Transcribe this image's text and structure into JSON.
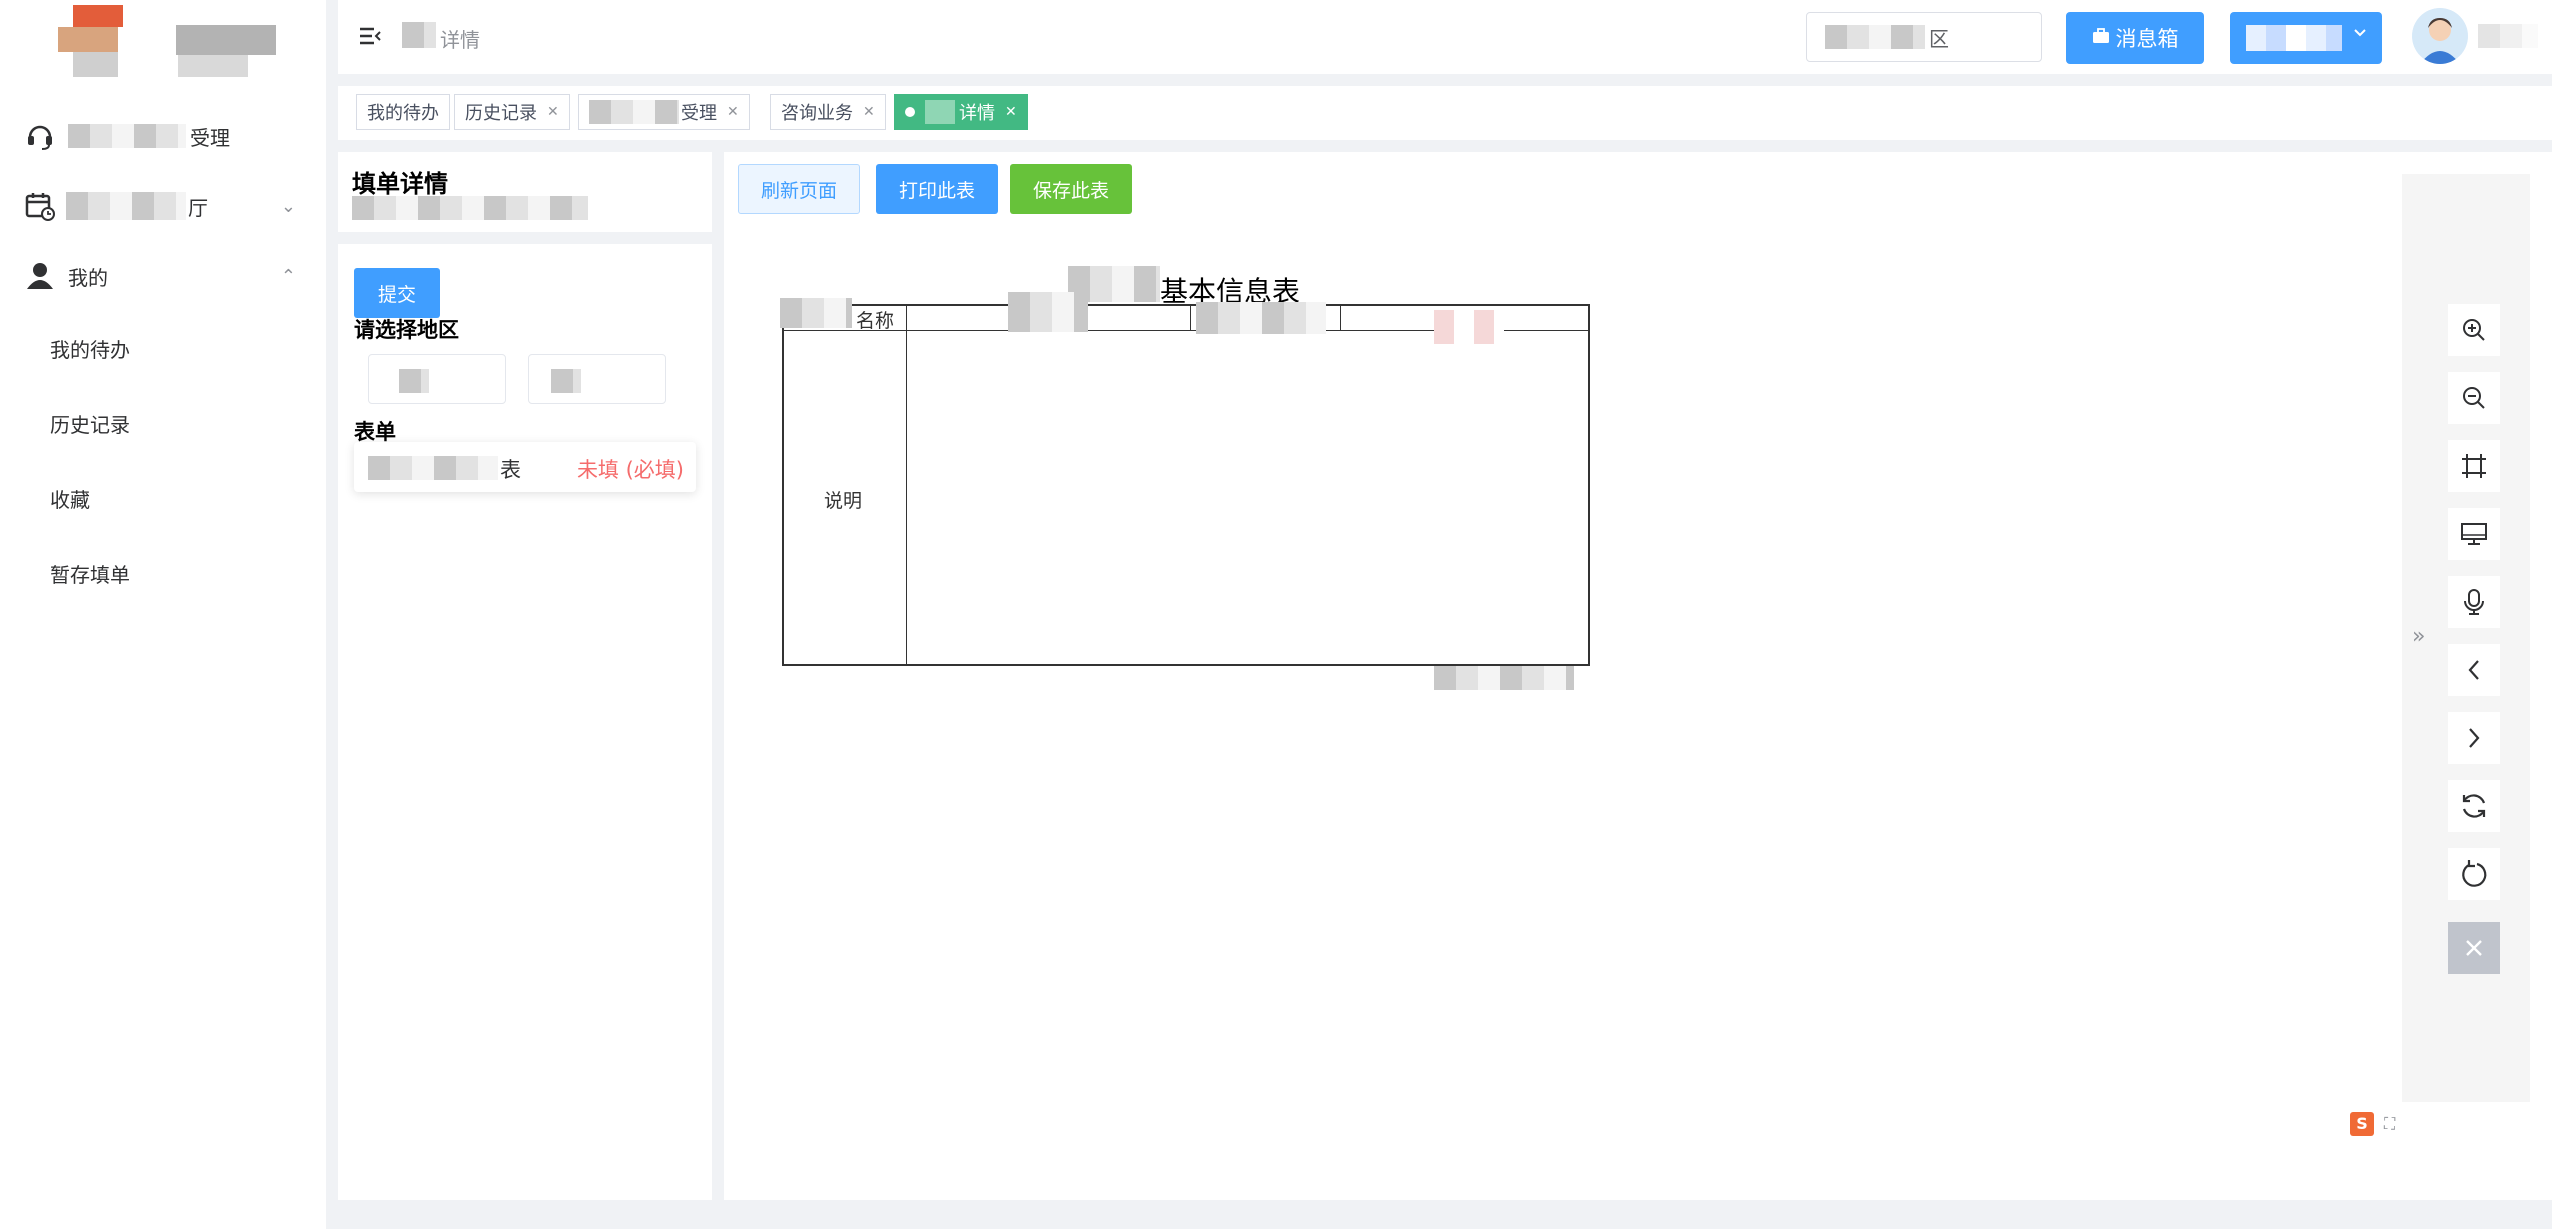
{
  "sidebar": {
    "items": [
      {
        "label": "受理",
        "icon": "headset-icon"
      },
      {
        "label": "厅",
        "icon": "calendar-icon"
      },
      {
        "label": "我的",
        "icon": "user-icon"
      }
    ],
    "sub_items": [
      "我的待办",
      "历史记录",
      "收藏",
      "暂存填单"
    ]
  },
  "header": {
    "breadcrumb": "详情",
    "search_text": "区",
    "message_button": "消息箱"
  },
  "tabs": [
    {
      "label": "我的待办",
      "closable": false
    },
    {
      "label": "历史记录",
      "closable": true
    },
    {
      "label": "受理",
      "closable": true
    },
    {
      "label": "咨询业务",
      "closable": true
    },
    {
      "label": "详情",
      "closable": true,
      "active": true
    }
  ],
  "left_panel": {
    "title": "填单详情",
    "submit_button": "提交",
    "region_label": "请选择地区",
    "form_label": "表单",
    "form_item": {
      "name": "表",
      "status": "未填 (必填)"
    }
  },
  "actions": {
    "refresh": "刷新页面",
    "print": "打印此表",
    "save": "保存此表"
  },
  "document": {
    "title": "基本信息表",
    "name_label": "名称",
    "desc_label": "说明"
  },
  "toolbar": {
    "buttons": [
      "zoom-in-icon",
      "zoom-out-icon",
      "crop-icon",
      "monitor-icon",
      "microphone-icon",
      "chevron-left-icon",
      "chevron-right-icon",
      "refresh-icon",
      "rotate-icon",
      "close-icon"
    ]
  },
  "colors": {
    "primary": "#409eff",
    "success": "#67c23a",
    "active_tag": "#42b983",
    "danger": "#f56c6c"
  }
}
